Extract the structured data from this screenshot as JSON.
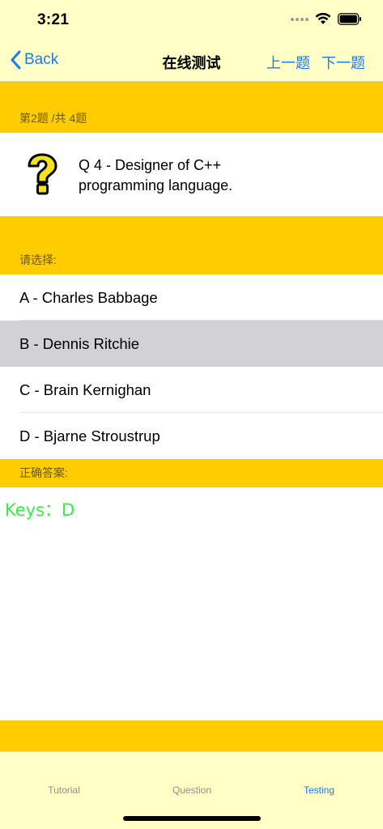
{
  "status_bar": {
    "time": "3:21"
  },
  "nav": {
    "back_label": "Back",
    "title": "在线测试",
    "prev_label": "上一题",
    "next_label": "下一题"
  },
  "progress": {
    "text": "第2题 /共 4题"
  },
  "question": {
    "text": "Q 4 - Designer of C++ programming language.",
    "icon": "question-mark-icon"
  },
  "choices_header": "请选择:",
  "options": [
    {
      "label": "A - Charles Babbage",
      "selected": false
    },
    {
      "label": "B - Dennis Ritchie",
      "selected": true
    },
    {
      "label": "C - Brain Kernighan",
      "selected": false
    },
    {
      "label": "D - Bjarne Stroustrup",
      "selected": false
    }
  ],
  "answer_header": "正确答案:",
  "answer": {
    "text": "Keys：D",
    "color": "#3ee84a"
  },
  "tabs": [
    {
      "label": "Tutorial",
      "active": false
    },
    {
      "label": "Question",
      "active": false
    },
    {
      "label": "Testing",
      "active": true
    }
  ],
  "colors": {
    "accent": "#1a7cf5",
    "header_band": "#FFCC00",
    "bar_bg": "#FFFFC6",
    "selected_row": "#D1D1D6"
  }
}
